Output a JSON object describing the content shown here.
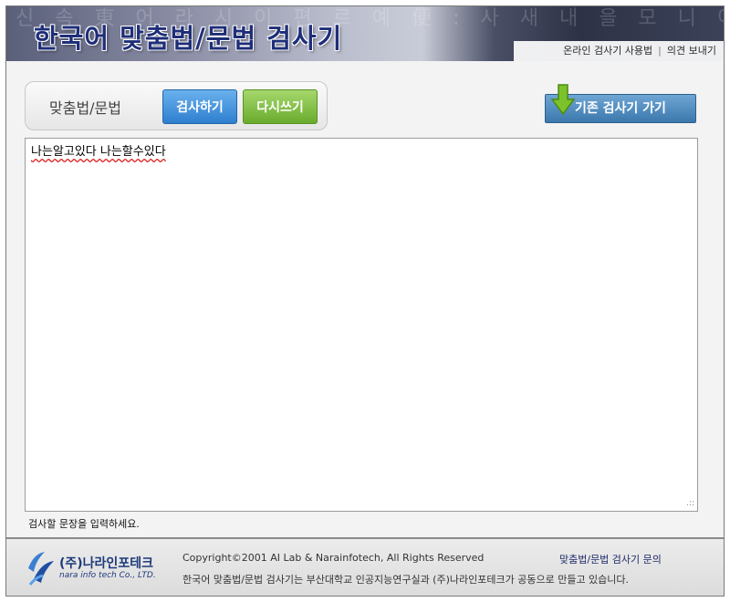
{
  "header": {
    "title": "한국어 맞춤법/문법 검사기",
    "background_glyphs": "신 속 東 어 라 시 이 편 르 예 便 : 사 새 내 을 모 니 이 文 나",
    "links": [
      {
        "label": "온라인 검사기 사용법"
      },
      {
        "label": "의견 보내기"
      }
    ],
    "link_separator": "|"
  },
  "toolbar": {
    "mode_label": "맞춤법/문법",
    "check_label": "검사하기",
    "reset_label": "다시쓰기",
    "old_checker_label": "기존 검사기 가기"
  },
  "editor": {
    "value": "나는알고있다 나는할수있다",
    "resize_grip": ".::",
    "hint": "검사할 문장을 입력하세요."
  },
  "footer": {
    "logo_ko": "(주)나라인포테크",
    "logo_en": "nara info tech Co., LTD.",
    "copyright": "Copyright©2001 AI Lab & Narainfotech, All Rights Reserved",
    "inquiry_link": "맞춤법/문법 검사기 문의",
    "credit": "한국어 맞춤법/문법 검사기는 부산대학교 인공지능연구실과 (주)나라인포테크가 공동으로 만들고 있습니다."
  },
  "colors": {
    "title": "#1e2e78",
    "check_button": "#2e7fce",
    "reset_button": "#6aab2d",
    "old_button": "#3c78ad",
    "arrow": "#7cc22a"
  }
}
